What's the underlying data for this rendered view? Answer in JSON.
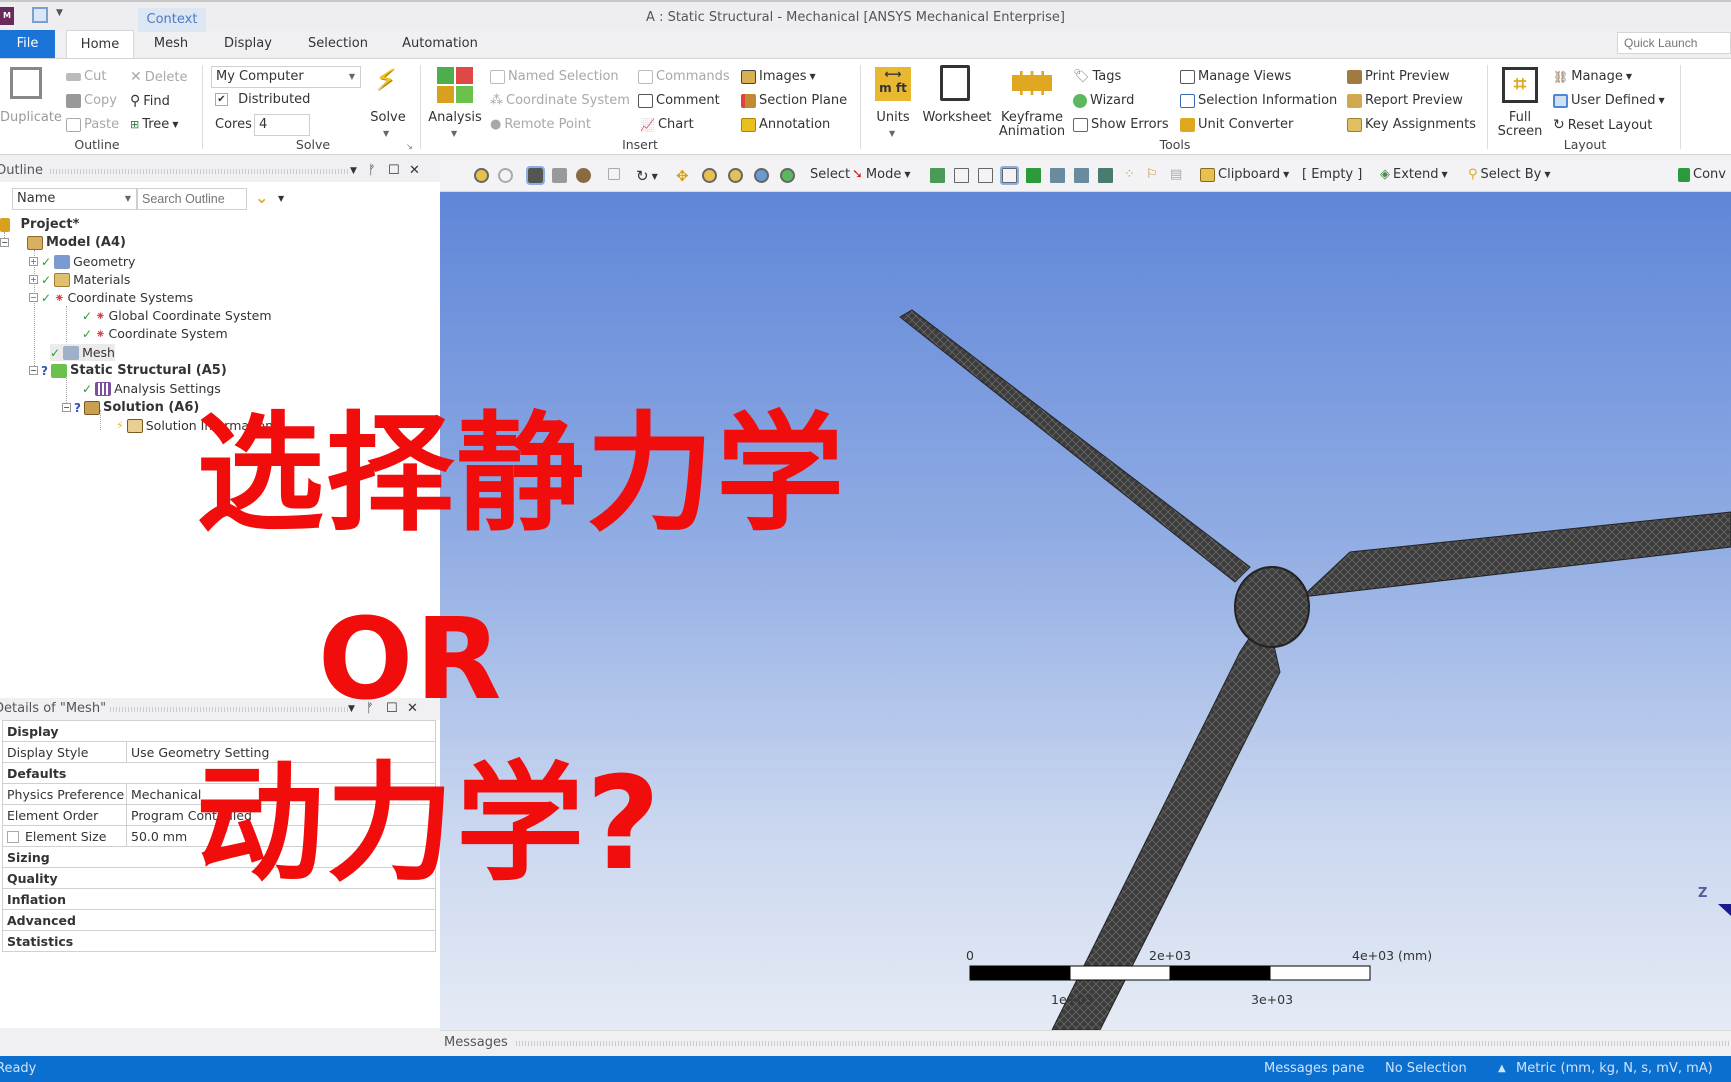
{
  "window": {
    "title": "A : Static Structural - Mechanical [ANSYS Mechanical Enterprise]",
    "context_tab": "Context",
    "quick_launch_placeholder": "Quick Launch"
  },
  "tabs": [
    "File",
    "Home",
    "Mesh",
    "Display",
    "Selection",
    "Automation"
  ],
  "active_tab": "Home",
  "ribbon": {
    "outline_group": {
      "label": "Outline",
      "duplicate": "Duplicate",
      "cut": "Cut",
      "copy": "Copy",
      "paste": "Paste",
      "delete": "Delete",
      "find": "Find",
      "tree": "Tree"
    },
    "solve_group": {
      "label": "Solve",
      "computer": "My Computer",
      "distributed": "Distributed",
      "distributed_checked": true,
      "cores_label": "Cores",
      "cores_value": "4",
      "solve": "Solve"
    },
    "insert_group": {
      "label": "Insert",
      "analysis": "Analysis",
      "named_selection": "Named Selection",
      "coordinate_system": "Coordinate System",
      "remote_point": "Remote Point",
      "commands": "Commands",
      "comment": "Comment",
      "chart": "Chart",
      "images": "Images",
      "section_plane": "Section Plane",
      "annotation": "Annotation"
    },
    "tools_group": {
      "label": "Tools",
      "units": "Units",
      "worksheet": "Worksheet",
      "keyframe_line1": "Keyframe",
      "keyframe_line2": "Animation",
      "tags": "Tags",
      "wizard": "Wizard",
      "show_errors": "Show Errors",
      "manage_views": "Manage Views",
      "selection_information": "Selection Information",
      "unit_converter": "Unit Converter",
      "print_preview": "Print Preview",
      "report_preview": "Report Preview",
      "key_assignments": "Key Assignments"
    },
    "layout_group": {
      "label": "Layout",
      "full_line1": "Full",
      "full_line2": "Screen",
      "manage": "Manage",
      "user_defined": "User Defined",
      "reset_layout": "Reset Layout"
    }
  },
  "outline": {
    "title": "Outline",
    "filter_value": "Name",
    "search_placeholder": "Search Outline",
    "tree": [
      {
        "label": "Project*",
        "bold": true
      },
      {
        "label": "Model (A4)",
        "bold": true
      },
      {
        "label": "Geometry",
        "status": "ok"
      },
      {
        "label": "Materials",
        "status": "ok"
      },
      {
        "label": "Coordinate Systems",
        "status": "ok"
      },
      {
        "label": "Global Coordinate System",
        "status": "ok"
      },
      {
        "label": "Coordinate System",
        "status": "ok"
      },
      {
        "label": "Mesh",
        "status": "ok"
      },
      {
        "label": "Static Structural (A5)",
        "bold": true,
        "status": "unknown"
      },
      {
        "label": "Analysis Settings",
        "status": "ok"
      },
      {
        "label": "Solution (A6)",
        "bold": true,
        "status": "unknown"
      },
      {
        "label": "Solution Information",
        "status": "pending"
      }
    ]
  },
  "details": {
    "title": "Details of \"Mesh\"",
    "rows": [
      {
        "section": "Display"
      },
      {
        "key": "Display Style",
        "value": "Use Geometry Setting"
      },
      {
        "section": "Defaults"
      },
      {
        "key": "Physics Preference",
        "value": "Mechanical"
      },
      {
        "key": "Element Order",
        "value": "Program Controlled"
      },
      {
        "key": "Element Size",
        "value": "50.0 mm",
        "checkbox": true
      },
      {
        "section": "Sizing"
      },
      {
        "section": "Quality"
      },
      {
        "section": "Inflation"
      },
      {
        "section": "Advanced"
      },
      {
        "section": "Statistics"
      }
    ]
  },
  "view_toolbar": {
    "select": "Select",
    "mode": "Mode",
    "clipboard": "Clipboard",
    "clipboard_state": "[ Empty ]",
    "extend": "Extend",
    "select_by": "Select By",
    "convert": "Conv"
  },
  "viewport": {
    "scale_labels": {
      "zero": "0",
      "one": "1e+03",
      "two": "2e+03",
      "three": "3e+03",
      "four": "4e+03 (mm)"
    },
    "triad_axis": "Z"
  },
  "overlay": {
    "line1": "选择静力学",
    "line2": "OR",
    "line3": "动力学?",
    "color": "#f20d0d"
  },
  "messages": {
    "title": "Messages"
  },
  "status": {
    "ready": "Ready",
    "messages_pane": "Messages pane",
    "selection": "No Selection",
    "units": "Metric (mm, kg, N, s, mV, mA)"
  }
}
